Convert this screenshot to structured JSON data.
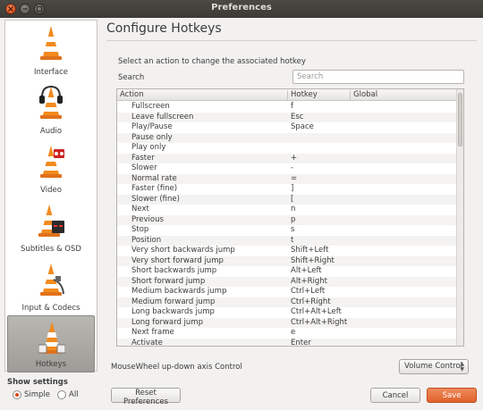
{
  "window": {
    "title": "Preferences"
  },
  "sidebar": {
    "items": [
      {
        "label": "Interface",
        "icon": "cone-interface-icon"
      },
      {
        "label": "Audio",
        "icon": "cone-headphones-icon"
      },
      {
        "label": "Video",
        "icon": "cone-film-icon"
      },
      {
        "label": "Subtitles & OSD",
        "icon": "cone-subtitles-icon"
      },
      {
        "label": "Input & Codecs",
        "icon": "cone-cable-icon"
      },
      {
        "label": "Hotkeys",
        "icon": "cone-hotkeys-icon",
        "active": true
      }
    ],
    "show_settings_label": "Show settings",
    "simple_label": "Simple",
    "all_label": "All",
    "selected_mode": "Simple"
  },
  "page": {
    "title": "Configure Hotkeys",
    "instruction": "Select an action to change the associated hotkey",
    "search_label": "Search",
    "search_placeholder": "Search"
  },
  "table": {
    "headers": {
      "action": "Action",
      "hotkey": "Hotkey",
      "global": "Global"
    },
    "rows": [
      {
        "action": "Fullscreen",
        "hotkey": "f",
        "global": ""
      },
      {
        "action": "Leave fullscreen",
        "hotkey": "Esc",
        "global": ""
      },
      {
        "action": "Play/Pause",
        "hotkey": "Space",
        "global": ""
      },
      {
        "action": "Pause only",
        "hotkey": "",
        "global": ""
      },
      {
        "action": "Play only",
        "hotkey": "",
        "global": ""
      },
      {
        "action": "Faster",
        "hotkey": "+",
        "global": ""
      },
      {
        "action": "Slower",
        "hotkey": "-",
        "global": ""
      },
      {
        "action": "Normal rate",
        "hotkey": "=",
        "global": ""
      },
      {
        "action": "Faster (fine)",
        "hotkey": "]",
        "global": ""
      },
      {
        "action": "Slower (fine)",
        "hotkey": "[",
        "global": ""
      },
      {
        "action": "Next",
        "hotkey": "n",
        "global": ""
      },
      {
        "action": "Previous",
        "hotkey": "p",
        "global": ""
      },
      {
        "action": "Stop",
        "hotkey": "s",
        "global": ""
      },
      {
        "action": "Position",
        "hotkey": "t",
        "global": ""
      },
      {
        "action": "Very short backwards jump",
        "hotkey": "Shift+Left",
        "global": ""
      },
      {
        "action": "Very short forward jump",
        "hotkey": "Shift+Right",
        "global": ""
      },
      {
        "action": "Short backwards jump",
        "hotkey": "Alt+Left",
        "global": ""
      },
      {
        "action": "Short forward jump",
        "hotkey": "Alt+Right",
        "global": ""
      },
      {
        "action": "Medium backwards jump",
        "hotkey": "Ctrl+Left",
        "global": ""
      },
      {
        "action": "Medium forward jump",
        "hotkey": "Ctrl+Right",
        "global": ""
      },
      {
        "action": "Long backwards jump",
        "hotkey": "Ctrl+Alt+Left",
        "global": ""
      },
      {
        "action": "Long forward jump",
        "hotkey": "Ctrl+Alt+Right",
        "global": ""
      },
      {
        "action": "Next frame",
        "hotkey": "e",
        "global": ""
      },
      {
        "action": "Activate",
        "hotkey": "Enter",
        "global": ""
      }
    ]
  },
  "mousewheel": {
    "label": "MouseWheel up-down axis Control",
    "value": "Volume Control"
  },
  "buttons": {
    "reset": "Reset Preferences",
    "cancel": "Cancel",
    "save": "Save"
  },
  "colors": {
    "accent": "#dd4814",
    "save_button": "#e8703f",
    "titlebar": "#3f3e3a"
  }
}
